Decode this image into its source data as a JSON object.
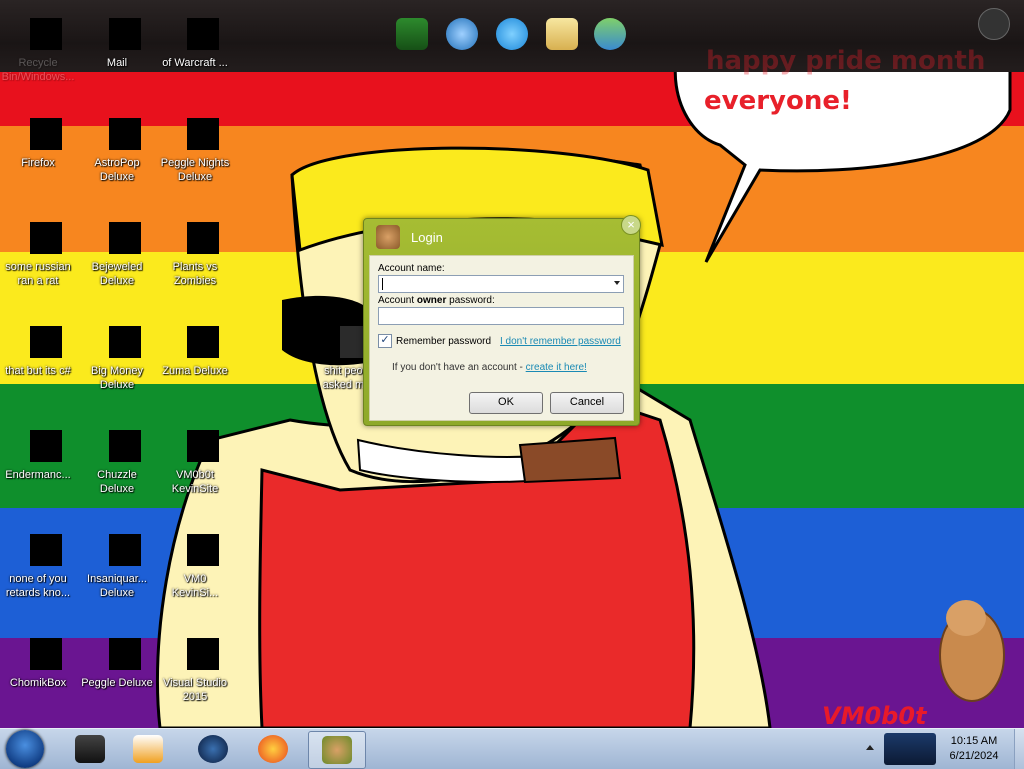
{
  "colors": {
    "red": "#e8111d",
    "orange": "#f7861f",
    "yellow": "#fbea1d",
    "green": "#0f8f2c",
    "blue": "#1d5fd6",
    "purple": "#6a1591",
    "skin": "#fdf3b7",
    "dialog_accent": "#9db52e"
  },
  "dock": [
    "winrar-icon",
    "network-icon",
    "internet-explorer-icon",
    "mail-icon",
    "messenger-icon"
  ],
  "desktop_icons_top": [
    {
      "label": "Recycle Bin/Windows..."
    },
    {
      "label": "Mail"
    },
    {
      "label": "of Warcraft ..."
    }
  ],
  "desktop_icons": [
    {
      "label": "Firefox",
      "icon": "firefox-icon"
    },
    {
      "label": "AstroPop\nDeluxe",
      "icon": "astropop-icon"
    },
    {
      "label": "Peggle Nights\nDeluxe",
      "icon": "peggle-nights-icon"
    },
    {
      "label": "some russian\nran a rat",
      "icon": "russian-rat-icon"
    },
    {
      "label": "Bejeweled\nDeluxe",
      "icon": "bejeweled-icon"
    },
    {
      "label": "Plants vs\nZombies",
      "icon": "plants-vs-zombies-icon"
    },
    {
      "label": "that but its c#",
      "icon": "folder-stack-icon"
    },
    {
      "label": "Big Money\nDeluxe",
      "icon": "big-money-icon"
    },
    {
      "label": "Zuma Deluxe",
      "icon": "zuma-icon"
    },
    {
      "label": "Endermanc...",
      "icon": "terminal-icon"
    },
    {
      "label": "Chuzzle\nDeluxe",
      "icon": "chuzzle-icon"
    },
    {
      "label": "VM0b0t\nKevinSite",
      "icon": "vm-kevinsite-icon"
    },
    {
      "label": "none of you\nretards kno...",
      "icon": "chrome-like-icon"
    },
    {
      "label": "Insaniquar...\nDeluxe",
      "icon": "insaniquarium-icon"
    },
    {
      "label": "VM0\nKevinSi...",
      "icon": "vm-kevinsite-2-icon"
    },
    {
      "label": "ChomikBox",
      "icon": "chomikbox-icon"
    },
    {
      "label": "Peggle Deluxe",
      "icon": "peggle-icon"
    },
    {
      "label": "Visual Studio\n2015",
      "icon": "visual-studio-icon"
    }
  ],
  "middle_icon": {
    "label": "shit peo...\nasked m..."
  },
  "speech": {
    "line1": "happy pride month",
    "line2": "everyone!"
  },
  "signature": "VM0b0t",
  "login": {
    "title": "Login",
    "account_name_label": "Account name:",
    "password_label_prefix": "Account ",
    "password_label_bold": "owner",
    "password_label_suffix": " password:",
    "account_name_value": "",
    "password_value": "",
    "remember_label": "Remember password",
    "remember_checked": true,
    "forgot_link": "I don't remember password",
    "no_account_text": "If you don't have an account - ",
    "create_link": "create it here!",
    "ok_label": "OK",
    "cancel_label": "Cancel",
    "close_glyph": "×"
  },
  "taskbar": {
    "items": [
      "media-app-icon",
      "media-player-icon",
      "globe-icon",
      "firefox-icon",
      "chomikbox-icon"
    ],
    "clock_time": "10:15 AM",
    "clock_date": "6/21/2024"
  }
}
